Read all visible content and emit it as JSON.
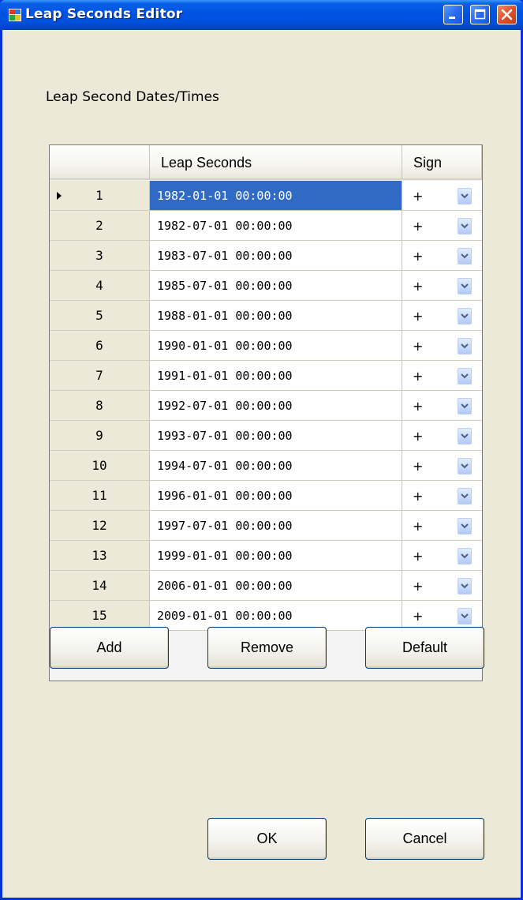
{
  "window": {
    "title": "Leap Seconds Editor"
  },
  "section": {
    "label": "Leap Second Dates/Times"
  },
  "grid": {
    "columns": [
      "",
      "Leap Seconds",
      "Sign"
    ],
    "selected_row": 1,
    "rows": [
      {
        "num": "1",
        "date": "1982-01-01 00:00:00",
        "sign": "+"
      },
      {
        "num": "2",
        "date": "1982-07-01 00:00:00",
        "sign": "+"
      },
      {
        "num": "3",
        "date": "1983-07-01 00:00:00",
        "sign": "+"
      },
      {
        "num": "4",
        "date": "1985-07-01 00:00:00",
        "sign": "+"
      },
      {
        "num": "5",
        "date": "1988-01-01 00:00:00",
        "sign": "+"
      },
      {
        "num": "6",
        "date": "1990-01-01 00:00:00",
        "sign": "+"
      },
      {
        "num": "7",
        "date": "1991-01-01 00:00:00",
        "sign": "+"
      },
      {
        "num": "8",
        "date": "1992-07-01 00:00:00",
        "sign": "+"
      },
      {
        "num": "9",
        "date": "1993-07-01 00:00:00",
        "sign": "+"
      },
      {
        "num": "10",
        "date": "1994-07-01 00:00:00",
        "sign": "+"
      },
      {
        "num": "11",
        "date": "1996-01-01 00:00:00",
        "sign": "+"
      },
      {
        "num": "12",
        "date": "1997-07-01 00:00:00",
        "sign": "+"
      },
      {
        "num": "13",
        "date": "1999-01-01 00:00:00",
        "sign": "+"
      },
      {
        "num": "14",
        "date": "2006-01-01 00:00:00",
        "sign": "+"
      },
      {
        "num": "15",
        "date": "2009-01-01 00:00:00",
        "sign": "+"
      }
    ]
  },
  "buttons": {
    "add": "Add",
    "remove": "Remove",
    "default": "Default",
    "ok": "OK",
    "cancel": "Cancel"
  },
  "colors": {
    "titlebar": "#0054e3",
    "selection": "#316ac5",
    "face": "#ece9d8",
    "close": "#e0522c"
  }
}
